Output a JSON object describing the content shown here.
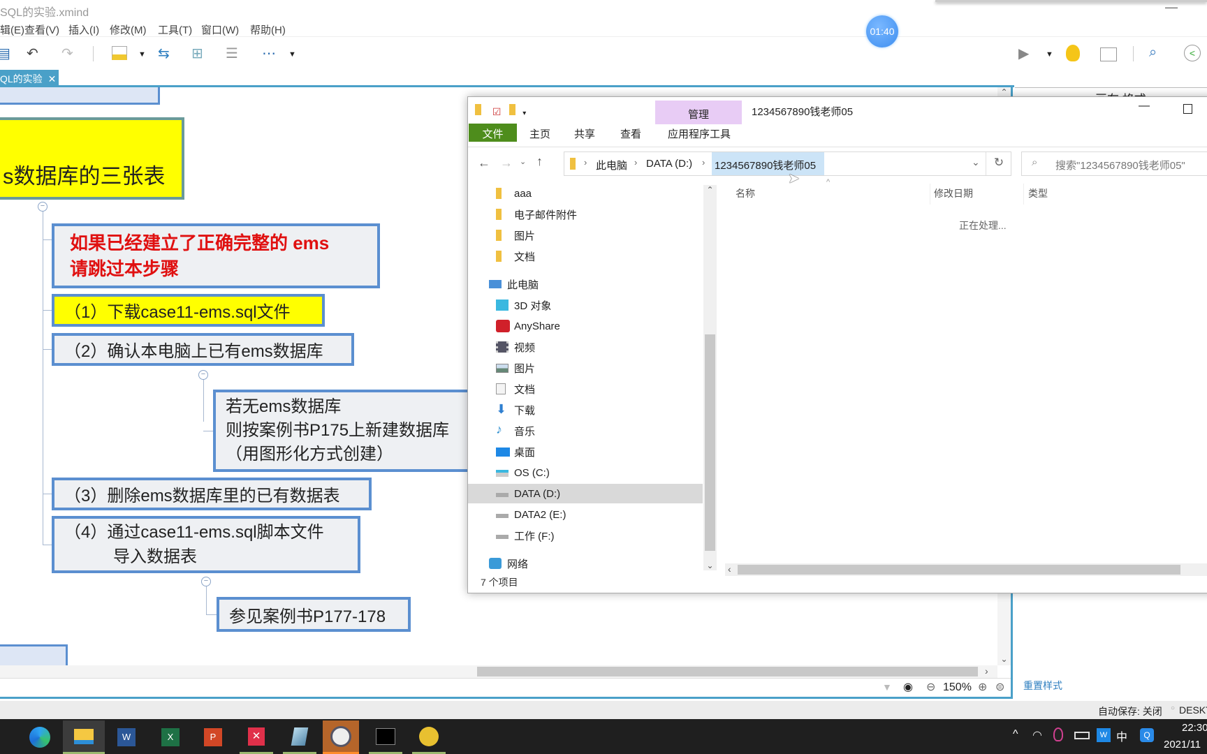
{
  "app": {
    "title": "SQL的实验.xmind",
    "menu": [
      "辑(E)",
      "查看(V)",
      "插入(I)",
      "修改(M)",
      "工具(T)",
      "窗口(W)",
      "帮助(H)"
    ],
    "tab_label": "QL的实验",
    "timer": "01:40",
    "right_panel_title": "画布 格式",
    "reset_style": "重置样式",
    "zoom": "150%",
    "autosave": "自动保存: 关闭",
    "computer": "DESKTO"
  },
  "mindmap": {
    "top_node": "",
    "main_node": "s数据库的三张表",
    "warning_lines": [
      "如果已经建立了正确完整的 ems",
      "请跳过本步骤"
    ],
    "step1": "（1）下载case11-ems.sql文件",
    "step2": "（2）确认本电脑上已有ems数据库",
    "step2_sub": [
      "若无ems数据库",
      "则按案例书P175上新建数据库",
      "（用图形化方式创建）"
    ],
    "step3": "（3）删除ems数据库里的已有数据表",
    "step4": [
      "（4）通过case11-ems.sql脚本文件",
      "导入数据表"
    ],
    "step4_sub": "参见案例书P177-178"
  },
  "explorer": {
    "title": "1234567890钱老师05",
    "context_tab": "管理",
    "ribbon_tabs": [
      "文件",
      "主页",
      "共享",
      "查看"
    ],
    "context_subtab": "应用程序工具",
    "breadcrumb": [
      "此电脑",
      "DATA (D:)",
      "1234567890钱老师05"
    ],
    "search_placeholder": "搜索\"1234567890钱老师05\"",
    "nav_quick": [
      "aaa",
      "电子邮件附件",
      "图片",
      "文档"
    ],
    "nav_this_pc": "此电脑",
    "nav_pc_items": [
      "3D 对象",
      "AnyShare",
      "视频",
      "图片",
      "文档",
      "下载",
      "音乐",
      "桌面",
      "OS (C:)",
      "DATA (D:)",
      "DATA2 (E:)",
      "工作 (F:)"
    ],
    "nav_network": "网络",
    "selected_nav": "DATA (D:)",
    "columns": [
      "名称",
      "修改日期",
      "类型"
    ],
    "status_message": "正在处理...",
    "item_count": "7 个项目"
  },
  "taskbar": {
    "apps": [
      "edge",
      "file-explorer",
      "word",
      "excel",
      "powerpoint",
      "xmind",
      "notepad",
      "avatar-app",
      "terminal",
      "yellow-app"
    ],
    "ime": "中",
    "time": "22:30",
    "date": "2021/11"
  },
  "colors": {
    "accent": "#4aa0c8",
    "yellow_node": "#ffff00",
    "warning_text": "#e01010",
    "node_border": "#5b8fd0",
    "file_tab": "#4e8d1c",
    "manage_tab": "#e8ccf5",
    "selection": "#cce4f7"
  }
}
